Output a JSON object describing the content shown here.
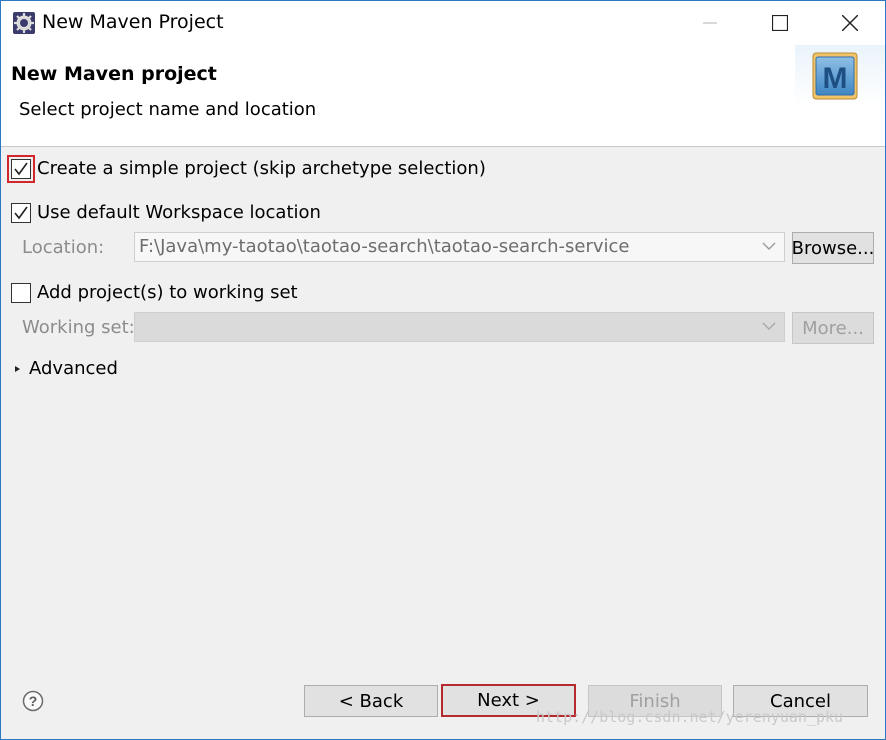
{
  "window": {
    "title": "New Maven Project"
  },
  "header": {
    "title": "New Maven project",
    "subtitle": "Select project name and location"
  },
  "options": {
    "simple_project": {
      "label": "Create a simple project (skip archetype selection)",
      "checked": true
    },
    "default_workspace": {
      "label": "Use default Workspace location",
      "checked": true
    },
    "working_set": {
      "label": "Add project(s) to working set",
      "checked": false
    }
  },
  "location": {
    "label": "Location:",
    "value": "F:\\Java\\my-taotao\\taotao-search\\taotao-search-service",
    "browse_label": "Browse..."
  },
  "working_set_field": {
    "label": "Working set:",
    "value": "",
    "more_label": "More..."
  },
  "advanced": {
    "label": "Advanced"
  },
  "footer": {
    "back_label": "< Back",
    "next_label": "Next >",
    "finish_label": "Finish",
    "cancel_label": "Cancel"
  },
  "watermark": "http://blog.csdn.net/yerenyuan_pku",
  "colors": {
    "highlight": "#d1262c",
    "window_border": "#2b79c2"
  }
}
